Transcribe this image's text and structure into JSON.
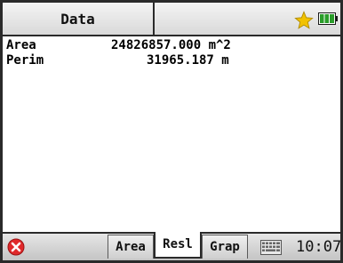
{
  "header": {
    "title": "Data",
    "icons": [
      "star-icon",
      "battery-icon"
    ]
  },
  "results": {
    "rows": [
      {
        "label": "Area",
        "value": "24826857.000 m^2"
      },
      {
        "label": "Perim",
        "value": "31965.187 m"
      }
    ]
  },
  "footer": {
    "close_icon": "close-icon",
    "tabs": [
      {
        "label": "Area",
        "active": false
      },
      {
        "label": "Resl",
        "active": true
      },
      {
        "label": "Grap",
        "active": false
      }
    ],
    "keyboard_icon": "keyboard-icon",
    "time": "10:07"
  },
  "colors": {
    "star": "#f2c200",
    "battery": "#2a9d2a",
    "close": "#e0282a"
  }
}
